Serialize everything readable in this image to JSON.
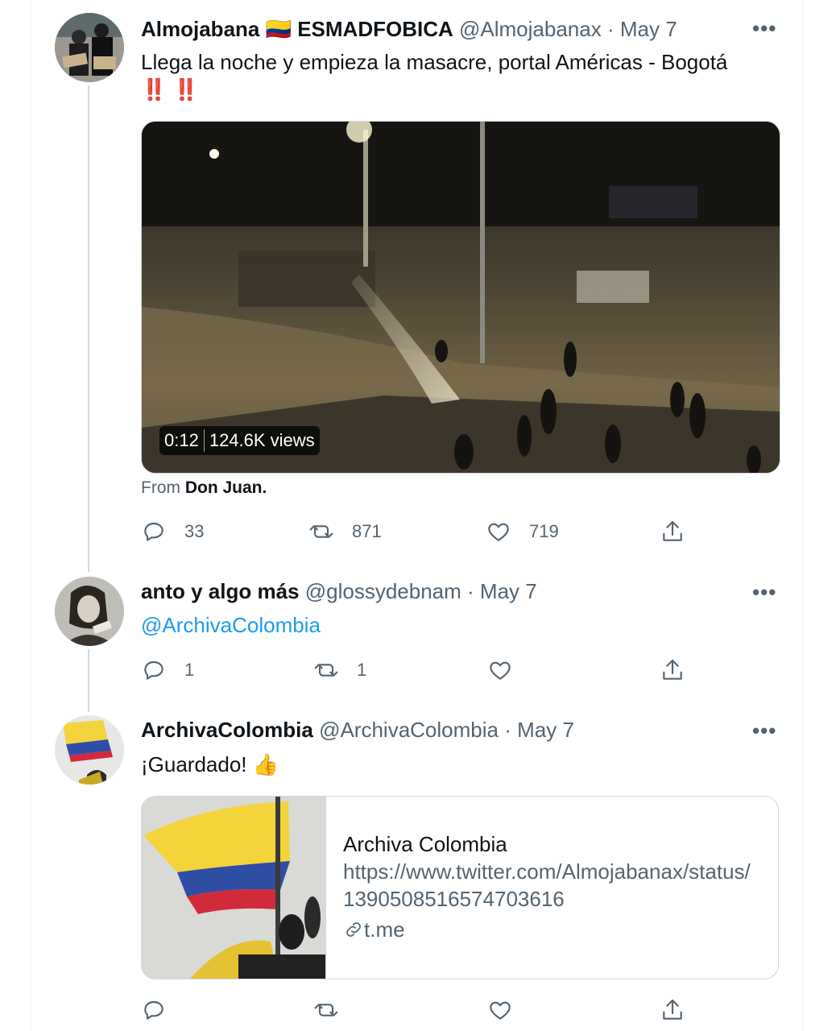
{
  "tweets": [
    {
      "name": "Almojabana",
      "flag": "🇨🇴",
      "name_suffix": "ESMADFOBICA",
      "handle": "@Almojabanax",
      "date": "· May 7",
      "text": "Llega la noche y empieza la masacre, portal Américas - Bogotá",
      "emoji_line": "‼️ ‼️",
      "video": {
        "duration": "0:12",
        "views": "124.6K views"
      },
      "from_label": "From",
      "from_source": "Don Juan.",
      "counts": {
        "reply": "33",
        "retweet": "871",
        "like": "719"
      }
    },
    {
      "name": "anto y algo más",
      "handle": "@glossydebnam",
      "date": "· May 7",
      "mention": "@ArchivaColombia",
      "counts": {
        "reply": "1",
        "retweet": "1",
        "like": ""
      }
    },
    {
      "name": "ArchivaColombia",
      "handle": "@ArchivaColombia",
      "date": "· May 7",
      "text": "¡Guardado!",
      "emoji": "👍",
      "card": {
        "title": "Archiva Colombia",
        "description": "https://www.twitter.com/Almojabanax/status/1390508516574703616",
        "domain": "t.me"
      },
      "counts": {
        "reply": "",
        "retweet": "",
        "like": ""
      }
    }
  ],
  "icons": [
    "more-icon",
    "reply-icon",
    "retweet-icon",
    "like-icon",
    "share-icon",
    "link-icon"
  ],
  "colors": {
    "accent": "#1d9bf0",
    "muted": "#536471",
    "text": "#0f1419",
    "border": "#cfd9de"
  }
}
